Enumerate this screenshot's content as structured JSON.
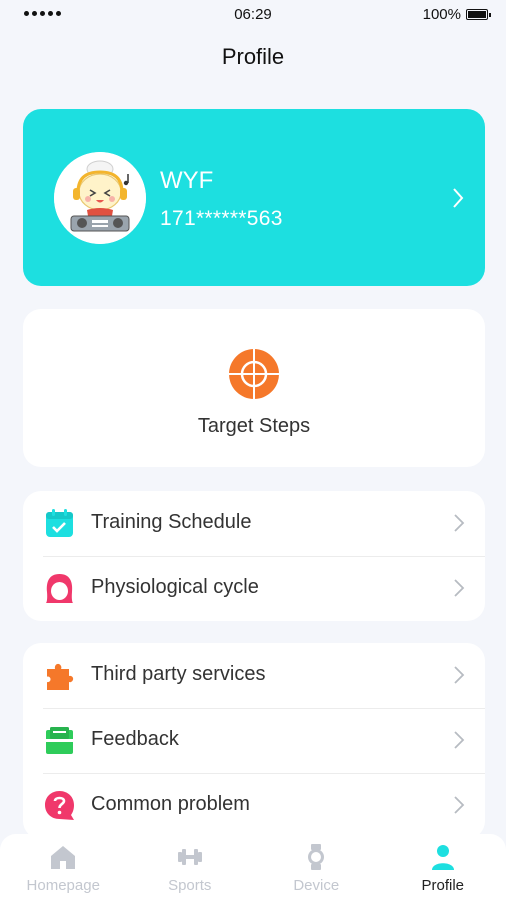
{
  "status_bar": {
    "time": "06:29",
    "battery": "100%"
  },
  "header": {
    "title": "Profile"
  },
  "profile": {
    "name": "WYF",
    "phone": "171******563"
  },
  "target": {
    "label": "Target Steps"
  },
  "menu_group_1": [
    {
      "label": "Training Schedule",
      "icon": "calendar-check-icon",
      "color": "#1ddfe0"
    },
    {
      "label": "Physiological cycle",
      "icon": "female-face-icon",
      "color": "#f0386b"
    }
  ],
  "menu_group_2": [
    {
      "label": "Third party services",
      "icon": "puzzle-icon",
      "color": "#f5782a"
    },
    {
      "label": "Feedback",
      "icon": "feedback-icon",
      "color": "#2ecc5a"
    },
    {
      "label": "Common problem",
      "icon": "question-bubble-icon",
      "color": "#f0386b"
    }
  ],
  "tabs": [
    {
      "label": "Homepage",
      "icon": "home-icon",
      "active": false
    },
    {
      "label": "Sports",
      "icon": "dumbbell-icon",
      "active": false
    },
    {
      "label": "Device",
      "icon": "watch-icon",
      "active": false
    },
    {
      "label": "Profile",
      "icon": "person-icon",
      "active": true
    }
  ],
  "colors": {
    "accent": "#1ddfe0",
    "target_orange": "#f5782a",
    "inactive_tab": "#c3c7cf"
  }
}
